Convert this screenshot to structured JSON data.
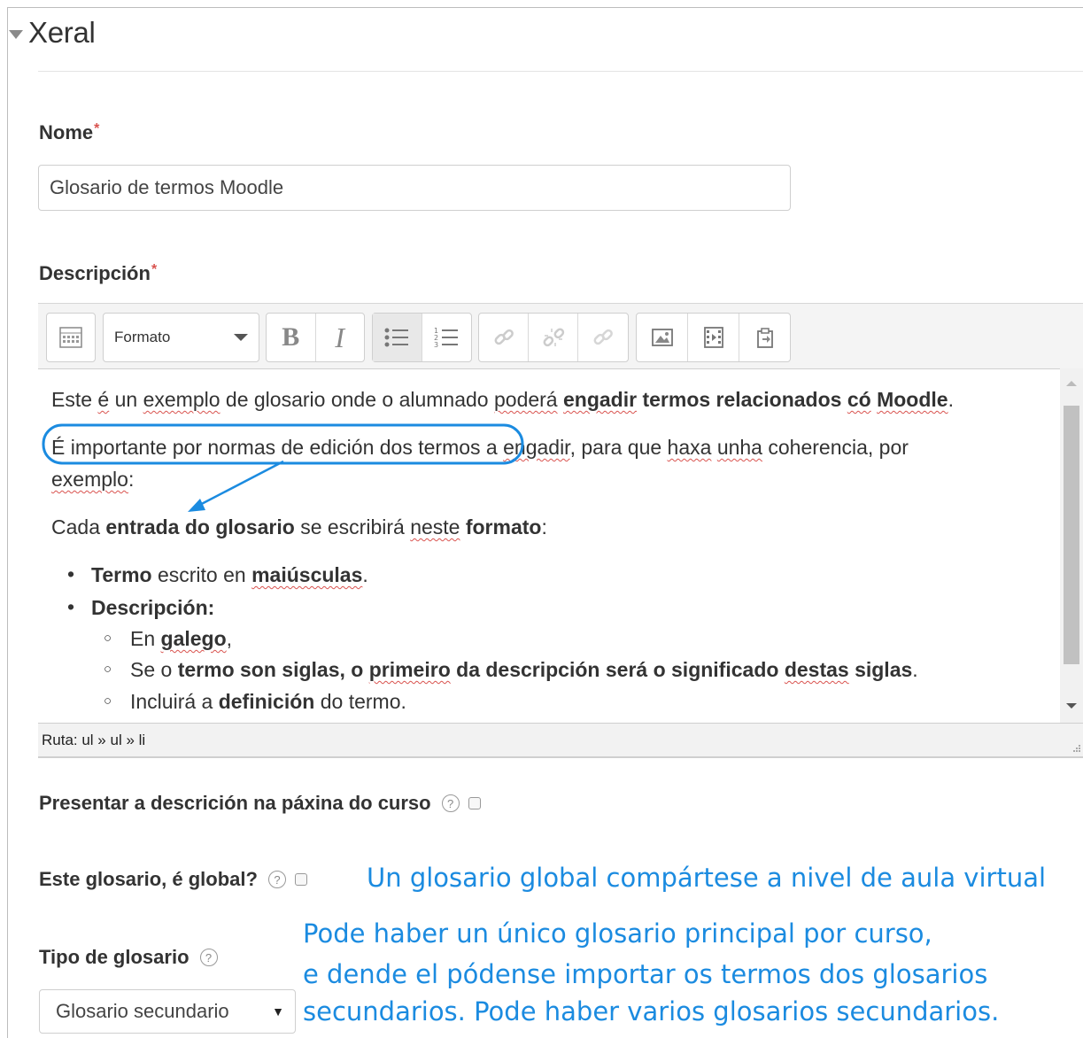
{
  "section": {
    "title": "Xeral"
  },
  "name_field": {
    "label": "Nome",
    "required": "*",
    "value": "Glosario de termos Moodle"
  },
  "description": {
    "label": "Descripción",
    "required": "*",
    "toolbar": {
      "format_label": "Formato",
      "bold": "B",
      "italic": "I",
      "icons": [
        "toolbar-toggle-icon",
        "unordered-list-icon",
        "ordered-list-icon",
        "link-icon",
        "unlink-icon",
        "auto-link-icon",
        "image-icon",
        "media-icon",
        "manage-files-icon"
      ]
    },
    "content": {
      "p1": {
        "a": "Este ",
        "b": "é",
        "c": " un ",
        "d": "exemplo",
        "e": " de glosario onde o alumnado ",
        "f": "poderá",
        "g": " ",
        "h": "engadir",
        "i": " termos relacionados ",
        "j": "có",
        "k": " ",
        "l": "Moodle",
        "m": "."
      },
      "p2": {
        "a": "É importante por normas de edición dos termos",
        "b": " a ",
        "c": "engadir",
        "d": ", para que ",
        "e": "haxa",
        "f": " ",
        "g": "unha",
        "h": " coherencia, por",
        "i": "exemplo",
        "j": ":"
      },
      "p3": {
        "a": "Cada ",
        "b": "entrada do glosario",
        "c": " se escribirá ",
        "d": "neste",
        "e": " ",
        "f": "formato",
        "g": ":"
      },
      "li1": {
        "a": "Termo",
        "b": " escrito en ",
        "c": "maiúsculas",
        "d": "."
      },
      "li2": {
        "a": "Descripción:"
      },
      "li2_1": {
        "a": "En ",
        "b": "galego",
        "c": ","
      },
      "li2_2": {
        "a": "Se o ",
        "b": "termo son siglas, o ",
        "c": "primeiro",
        "d": " da descripción será o significado ",
        "e": "destas",
        "f": " siglas",
        "g": "."
      },
      "li2_3": {
        "a": "Incluirá a ",
        "b": "definición",
        "c": " do termo."
      }
    },
    "path": "Ruta: ul » ul » li"
  },
  "show_description": {
    "label": "Presentar a descrición na páxina do curso",
    "help": "?"
  },
  "global": {
    "label": "Este glosario, é global?",
    "help": "?",
    "note": "Un glosario global compártese a nivel de aula virtual"
  },
  "glossary_type": {
    "label": "Tipo de glosario",
    "help": "?",
    "selected": "Glosario secundario",
    "arrow": "▼",
    "note_lines": [
      "Pode haber un único glosario principal por curso,",
      "e dende el pódense importar os termos dos glosarios",
      "secundarios. Pode haber varios glosarios secundarios."
    ]
  },
  "colors": {
    "annotation": "#1b8be0",
    "required": "#d9534f"
  }
}
